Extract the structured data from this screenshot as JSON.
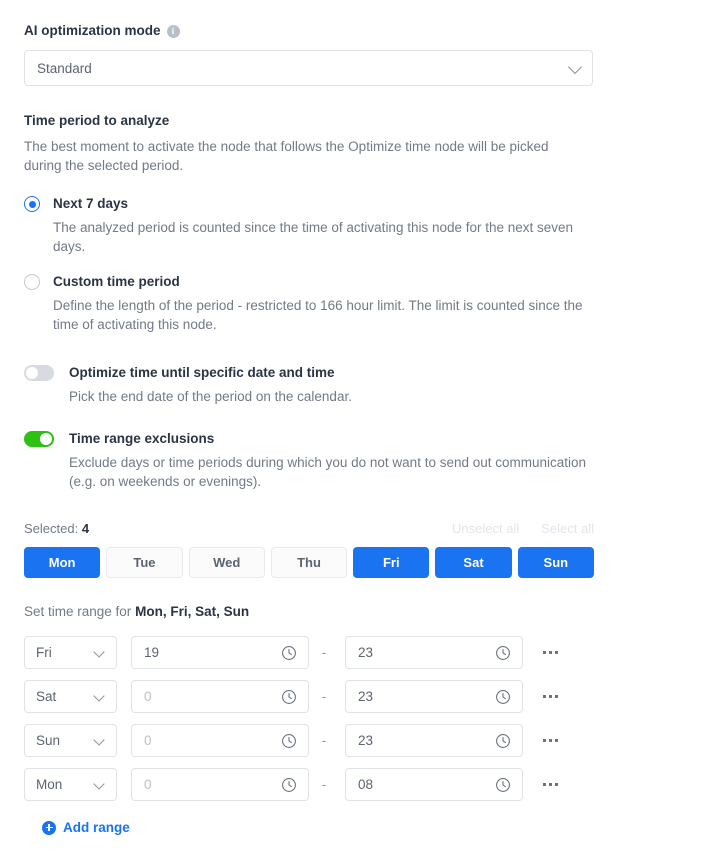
{
  "ai_mode": {
    "label": "AI optimization mode",
    "info_icon": "info-icon",
    "selected": "Standard",
    "chevron": "chevron-down-icon"
  },
  "time_period": {
    "label": "Time period to analyze",
    "description": "The best moment to activate the node that follows the Optimize time node will be picked during the selected period.",
    "options": [
      {
        "label": "Next 7 days",
        "description": "The analyzed period is counted since the time of activating this node for the next seven days.",
        "selected": true
      },
      {
        "label": "Custom time period",
        "description": "Define the length of the period - restricted to 166 hour limit. The limit is counted since the time of activating this node.",
        "selected": false
      }
    ]
  },
  "toggles": [
    {
      "label": "Optimize time until specific date and time",
      "description": "Pick the end date of the period on the calendar.",
      "on": false
    },
    {
      "label": "Time range exclusions",
      "description": "Exclude days or time periods during which you do not want to send out communication (e.g. on weekends or evenings).",
      "on": true
    }
  ],
  "day_selector": {
    "selected_prefix": "Selected:",
    "selected_count": "4",
    "unselect_all": "Unselect all",
    "select_all": "Select all",
    "days": [
      {
        "label": "Mon",
        "selected": true
      },
      {
        "label": "Tue",
        "selected": false
      },
      {
        "label": "Wed",
        "selected": false
      },
      {
        "label": "Thu",
        "selected": false
      },
      {
        "label": "Fri",
        "selected": true
      },
      {
        "label": "Sat",
        "selected": true
      },
      {
        "label": "Sun",
        "selected": true
      }
    ]
  },
  "time_ranges": {
    "heading_prefix": "Set time range for",
    "heading_days": "Mon, Fri, Sat, Sun",
    "separator": "-",
    "clock_icon": "clock-icon",
    "more_icon": "more-options-icon",
    "rows": [
      {
        "day": "Fri",
        "from": "19",
        "from_is_placeholder": false,
        "to": "23",
        "to_is_placeholder": false
      },
      {
        "day": "Sat",
        "from": "0",
        "from_is_placeholder": true,
        "to": "23",
        "to_is_placeholder": false
      },
      {
        "day": "Sun",
        "from": "0",
        "from_is_placeholder": true,
        "to": "23",
        "to_is_placeholder": false
      },
      {
        "day": "Mon",
        "from": "0",
        "from_is_placeholder": true,
        "to": "08",
        "to_is_placeholder": false
      }
    ],
    "add_range_label": "Add range",
    "add_icon": "plus-circle-icon"
  },
  "colors": {
    "accent_blue": "#1a73f0",
    "toggle_green": "#2fc016",
    "border": "#dfe3e8",
    "text_muted": "#727a87",
    "text_strong": "#2b3445"
  }
}
